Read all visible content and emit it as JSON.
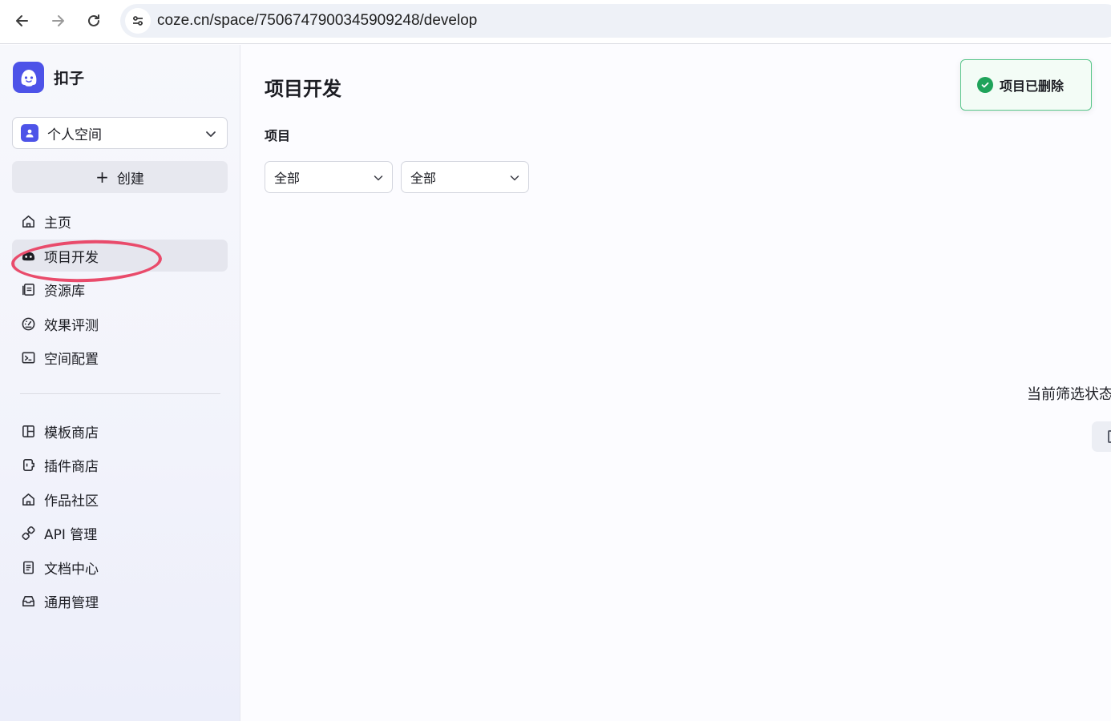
{
  "browser": {
    "url": "coze.cn/space/7506747900345909248/develop"
  },
  "app": {
    "name": "扣子",
    "brand_color": "#4d53e8"
  },
  "sidebar": {
    "space_selector": {
      "label": "个人空间"
    },
    "create_label": "创建",
    "primary_items": [
      {
        "label": "主页",
        "icon": "home-icon"
      },
      {
        "label": "项目开发",
        "icon": "project-dev-icon",
        "active": true
      },
      {
        "label": "资源库",
        "icon": "library-icon"
      },
      {
        "label": "效果评测",
        "icon": "gauge-icon"
      },
      {
        "label": "空间配置",
        "icon": "terminal-icon"
      }
    ],
    "secondary_items": [
      {
        "label": "模板商店",
        "icon": "template-icon"
      },
      {
        "label": "插件商店",
        "icon": "plugin-icon"
      },
      {
        "label": "作品社区",
        "icon": "community-icon"
      },
      {
        "label": "API 管理",
        "icon": "link-icon"
      },
      {
        "label": "文档中心",
        "icon": "document-icon"
      },
      {
        "label": "通用管理",
        "icon": "inbox-icon"
      }
    ]
  },
  "main": {
    "title": "项目开发",
    "section_label": "项目",
    "filters": [
      {
        "value": "全部"
      },
      {
        "value": "全部"
      }
    ],
    "empty_state_text": "当前筛选状态"
  },
  "toast": {
    "message": "项目已删除",
    "status_color": "#1fa35a"
  },
  "annotation": {
    "color": "#e94b6b"
  }
}
